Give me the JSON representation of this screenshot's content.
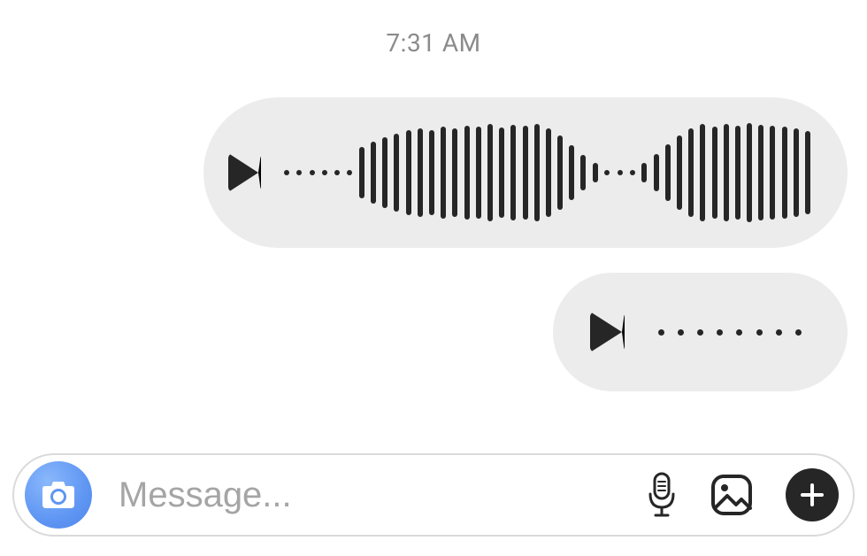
{
  "timestamp": "7:31 AM",
  "messages": [
    {
      "type": "voice",
      "play_label": "Play",
      "amplitudes": [
        4,
        4,
        4,
        4,
        4,
        4,
        58,
        70,
        80,
        88,
        96,
        100,
        96,
        104,
        100,
        106,
        104,
        110,
        102,
        108,
        106,
        110,
        100,
        84,
        62,
        40,
        22,
        6,
        6,
        6,
        22,
        42,
        64,
        84,
        100,
        110,
        104,
        110,
        106,
        112,
        108,
        106,
        104,
        100,
        94
      ]
    },
    {
      "type": "voice",
      "play_label": "Play",
      "amplitudes": [
        4,
        4,
        4,
        4,
        4,
        4,
        4,
        4
      ]
    }
  ],
  "composer": {
    "placeholder": "Message...",
    "camera_label": "Camera",
    "mic_label": "Voice message",
    "gallery_label": "Gallery",
    "more_label": "More"
  },
  "colors": {
    "waveform": "#262626",
    "bubble": "#ececec",
    "placeholder": "#a5a5a5",
    "timestamp": "#8b8b8b",
    "camera_accent": "#5f96f3"
  }
}
